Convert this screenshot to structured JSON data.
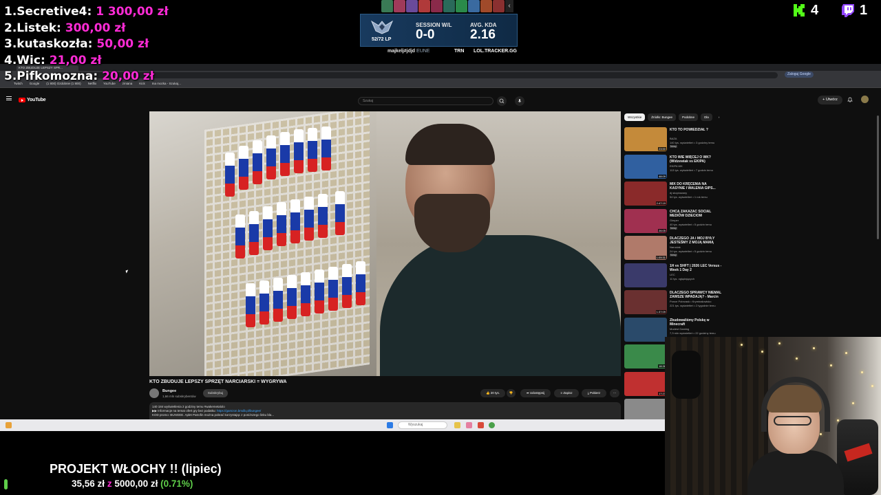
{
  "donations": [
    {
      "rank": "1.",
      "name": "Secretive4:",
      "amount": "1 300,00 zł"
    },
    {
      "rank": "2.",
      "name": "Listek:",
      "amount": "300,00 zł"
    },
    {
      "rank": "3.",
      "name": "kutaskozła:",
      "amount": "50,00 zł"
    },
    {
      "rank": "4.",
      "name": "Wic:",
      "amount": "21,00 zł"
    },
    {
      "rank": "5.",
      "name": "Pifkomozna:",
      "amount": "20,00 zł"
    }
  ],
  "lol_tracker": {
    "lp": "52/72 LP",
    "session_label": "SESSION W/L",
    "session_value": "0-0",
    "kda_label": "AVG. KDA",
    "kda_value": "2.16",
    "summoner": "majkelj#jdjd",
    "region": "EUNE",
    "brand": "TRN",
    "site": "LOL.TRACKER.GG",
    "champion_colors": [
      "#3a7a55",
      "#a03a5a",
      "#6a4a9a",
      "#b03a3a",
      "#8a2a4a",
      "#2a6a5a",
      "#2a8a4a",
      "#3a6aa0",
      "#a04a2a",
      "#8a3030"
    ]
  },
  "followers": {
    "kick_count": "4",
    "twitch_count": "1",
    "kick_color": "#53fc18",
    "twitch_color": "#9146ff"
  },
  "browser": {
    "tab_title": "KTO ZBUDUJE LEPSZY SPR...",
    "sign_in_label": "Zaloguj Google",
    "bookmarks": [
      "Twitch",
      "Google",
      "(1 800) Ozdobnie (1 800)",
      "Netflix",
      "YouTube",
      "zmiana",
      "Kick",
      "Ina mozka - Szukaj..."
    ]
  },
  "youtube": {
    "logo_text": "YouTube",
    "search_placeholder": "Szukaj",
    "create_label": "Utwórz",
    "video_title": "KTO ZBUDUJE LEPSZY SPRZĘT NARCIARSKI = WYGRYWA",
    "channel_name": "Bungee",
    "channel_subs": "1,66 mln subskrybentów",
    "subscribe_label": "Subskrybuj",
    "likes": "20 tys.",
    "share_label": "Udostępnij",
    "save_label": "Zapisz",
    "download_label": "Pobierz",
    "description_line1": "140 184 wyświetlenia  2 godziny temu  #wakemetalolo",
    "description_line2_text": "▶▶ Informacje na temat ofert gry bez podatku: ",
    "description_line2_link": "https://gamzon.bmdb.pl/bungee/",
    "description_line3": "KOD promo: BUNGEE. Aplet Patrofin można pobrać korzystając z poniższego linku bla...",
    "chips": [
      "Wszystkie",
      "Źródło: Bungee",
      "Podobne",
      "Dla"
    ],
    "recommendations": [
      {
        "title": "KTO TO POWIEDZIAŁ ?",
        "channel": "BAZA",
        "meta": "140 tys. wyświetleń • 3 godziny temu",
        "badge": "Nowy",
        "duration": "23:50",
        "color": "#c48a3a"
      },
      {
        "title": "KTO WIE WIĘCEJ O WK? (Widzewiak vs EKIPA)",
        "channel": "EKIPA WK",
        "meta": "113 tys. wyświetleń • 7 godzin temu",
        "badge": "",
        "duration": "48:09",
        "color": "#3060a0"
      },
      {
        "title": "MIX DO KRĘCENIA NA KASYNIE I WALENIA GIPS...",
        "channel": "dj skopiowany",
        "meta": "54 tys. wyświetleń • 1 rok temu",
        "badge": "",
        "duration": "2:47:19",
        "color": "#8a2a2a"
      },
      {
        "title": "CHCĄ ZAKAZAĆ SOCIAL MEDIÓW DZIECIOM",
        "channel": "Gimper",
        "meta": "40 tys. wyświetleń • 5 godzin temu",
        "badge": "Nowy",
        "duration": "26:05",
        "color": "#a03050"
      },
      {
        "title": "DLACZEGO JA i MÓJ BYŁY JESTEŚMY Z MOJĄ MAMĄ",
        "channel": "Naruciak",
        "meta": "24 tys. wyświetleń • 5 godzin temu",
        "badge": "Nowy",
        "duration": "1:09:31",
        "color": "#b07a6a"
      },
      {
        "title": "1H vs SHFT | 2026 LEC Versus - Week 1 Day 2",
        "channel": "LEC",
        "meta": "11 tys. oglądających",
        "badge": "",
        "duration": "",
        "color": "#3a3a6a"
      },
      {
        "title": "DLACZEGO SPRAWCY NIEMAL ZAWSZE WPADAJĄ? - Marcin ...",
        "channel": "Ponce Pobrzask • Kryminalowisko",
        "meta": "221 tys. wyświetleń • 2 tygodnie temu",
        "badge": "",
        "duration": "1:37:09",
        "color": "#6a3030"
      },
      {
        "title": "Zbudowaliśmy Polskę w Minecraft",
        "channel": "Modest Gaming",
        "meta": "7,3 mln wyświetleń • 22 godziny temu",
        "badge": "",
        "duration": "",
        "color": "#2a4a6a"
      },
      {
        "title": "",
        "channel": "",
        "meta": "",
        "badge": "",
        "duration": "18:36",
        "color": "#3a8a4a"
      },
      {
        "title": "",
        "channel": "",
        "meta": "",
        "badge": "",
        "duration": "17:23",
        "color": "#c03030"
      },
      {
        "title": "",
        "channel": "",
        "meta": "",
        "badge": "",
        "duration": "",
        "color": "#8a8a8a"
      }
    ]
  },
  "taskbar": {
    "search_placeholder": "Wyszukaj"
  },
  "goal": {
    "title": "PROJEKT WŁOCHY !! (lipiec)",
    "current": "35,56 zł",
    "separator": "z",
    "target": "5000,00 zł",
    "percent": "(0.71%)",
    "progress_fraction": 0.0071
  }
}
